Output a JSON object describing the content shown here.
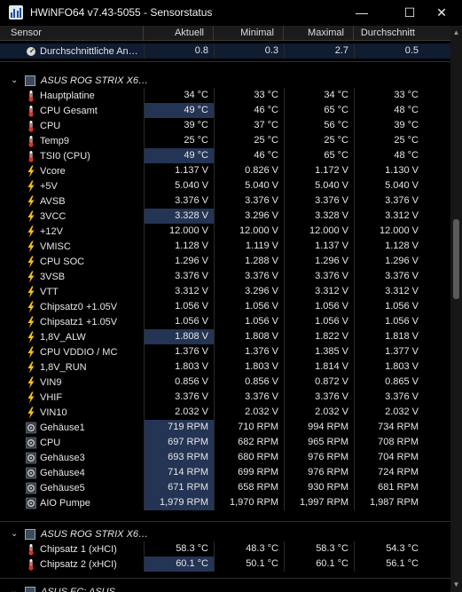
{
  "window": {
    "title": "HWiNFO64 v7.43-5055 - Sensorstatus",
    "minimize": "—",
    "maximize": "☐",
    "close": "✕"
  },
  "columns": {
    "sensor": "Sensor",
    "current": "Aktuell",
    "min": "Minimal",
    "max": "Maximal",
    "avg": "Durchschnitt"
  },
  "top_row": {
    "icon": "gauge-icon",
    "label": "Durchschnittliche An…",
    "current": "0.8",
    "min": "0.3",
    "max": "2.7",
    "avg": "0.5"
  },
  "group1": {
    "name": "ASUS ROG STRIX X6…",
    "rows": [
      {
        "icon": "thermometer-icon",
        "label": "Hauptplatine",
        "current": "34 °C",
        "min": "33 °C",
        "max": "34 °C",
        "avg": "33 °C",
        "hl": ""
      },
      {
        "icon": "thermometer-icon",
        "label": "CPU Gesamt",
        "current": "49 °C",
        "min": "46 °C",
        "max": "65 °C",
        "avg": "48 °C",
        "hl": "hl"
      },
      {
        "icon": "thermometer-icon",
        "label": "CPU",
        "current": "39 °C",
        "min": "37 °C",
        "max": "56 °C",
        "avg": "39 °C",
        "hl": ""
      },
      {
        "icon": "thermometer-icon",
        "label": "Temp9",
        "current": "25 °C",
        "min": "25 °C",
        "max": "25 °C",
        "avg": "25 °C",
        "hl": ""
      },
      {
        "icon": "thermometer-icon",
        "label": "TSI0 (CPU)",
        "current": "49 °C",
        "min": "46 °C",
        "max": "65 °C",
        "avg": "48 °C",
        "hl": "hl"
      },
      {
        "icon": "voltage-icon",
        "label": "Vcore",
        "current": "1.137 V",
        "min": "0.826 V",
        "max": "1.172 V",
        "avg": "1.130 V",
        "hl": ""
      },
      {
        "icon": "voltage-icon",
        "label": "+5V",
        "current": "5.040 V",
        "min": "5.040 V",
        "max": "5.040 V",
        "avg": "5.040 V",
        "hl": ""
      },
      {
        "icon": "voltage-icon",
        "label": "AVSB",
        "current": "3.376 V",
        "min": "3.376 V",
        "max": "3.376 V",
        "avg": "3.376 V",
        "hl": ""
      },
      {
        "icon": "voltage-icon",
        "label": "3VCC",
        "current": "3.328 V",
        "min": "3.296 V",
        "max": "3.328 V",
        "avg": "3.312 V",
        "hl": "hl"
      },
      {
        "icon": "voltage-icon",
        "label": "+12V",
        "current": "12.000 V",
        "min": "12.000 V",
        "max": "12.000 V",
        "avg": "12.000 V",
        "hl": ""
      },
      {
        "icon": "voltage-icon",
        "label": "VMISC",
        "current": "1.128 V",
        "min": "1.119 V",
        "max": "1.137 V",
        "avg": "1.128 V",
        "hl": ""
      },
      {
        "icon": "voltage-icon",
        "label": "CPU SOC",
        "current": "1.296 V",
        "min": "1.288 V",
        "max": "1.296 V",
        "avg": "1.296 V",
        "hl": ""
      },
      {
        "icon": "voltage-icon",
        "label": "3VSB",
        "current": "3.376 V",
        "min": "3.376 V",
        "max": "3.376 V",
        "avg": "3.376 V",
        "hl": ""
      },
      {
        "icon": "voltage-icon",
        "label": "VTT",
        "current": "3.312 V",
        "min": "3.296 V",
        "max": "3.312 V",
        "avg": "3.312 V",
        "hl": ""
      },
      {
        "icon": "voltage-icon",
        "label": "Chipsatz0 +1.05V",
        "current": "1.056 V",
        "min": "1.056 V",
        "max": "1.056 V",
        "avg": "1.056 V",
        "hl": ""
      },
      {
        "icon": "voltage-icon",
        "label": "Chipsatz1 +1.05V",
        "current": "1.056 V",
        "min": "1.056 V",
        "max": "1.056 V",
        "avg": "1.056 V",
        "hl": ""
      },
      {
        "icon": "voltage-icon",
        "label": "1,8V_ALW",
        "current": "1.808 V",
        "min": "1.808 V",
        "max": "1.822 V",
        "avg": "1.818 V",
        "hl": "hl"
      },
      {
        "icon": "voltage-icon",
        "label": "CPU VDDIO / MC",
        "current": "1.376 V",
        "min": "1.376 V",
        "max": "1.385 V",
        "avg": "1.377 V",
        "hl": ""
      },
      {
        "icon": "voltage-icon",
        "label": "1,8V_RUN",
        "current": "1.803 V",
        "min": "1.803 V",
        "max": "1.814 V",
        "avg": "1.803 V",
        "hl": ""
      },
      {
        "icon": "voltage-icon",
        "label": "VIN9",
        "current": "0.856 V",
        "min": "0.856 V",
        "max": "0.872 V",
        "avg": "0.865 V",
        "hl": ""
      },
      {
        "icon": "voltage-icon",
        "label": "VHIF",
        "current": "3.376 V",
        "min": "3.376 V",
        "max": "3.376 V",
        "avg": "3.376 V",
        "hl": ""
      },
      {
        "icon": "voltage-icon",
        "label": "VIN10",
        "current": "2.032 V",
        "min": "2.032 V",
        "max": "2.032 V",
        "avg": "2.032 V",
        "hl": ""
      },
      {
        "icon": "fan-icon",
        "label": "Gehäuse1",
        "current": "719 RPM",
        "min": "710 RPM",
        "max": "994 RPM",
        "avg": "734 RPM",
        "hl": "hl"
      },
      {
        "icon": "fan-icon",
        "label": "CPU",
        "current": "697 RPM",
        "min": "682 RPM",
        "max": "965 RPM",
        "avg": "708 RPM",
        "hl": "hl"
      },
      {
        "icon": "fan-icon",
        "label": "Gehäuse3",
        "current": "693 RPM",
        "min": "680 RPM",
        "max": "976 RPM",
        "avg": "704 RPM",
        "hl": "hl"
      },
      {
        "icon": "fan-icon",
        "label": "Gehäuse4",
        "current": "714 RPM",
        "min": "699 RPM",
        "max": "976 RPM",
        "avg": "724 RPM",
        "hl": "hl"
      },
      {
        "icon": "fan-icon",
        "label": "Gehäuse5",
        "current": "671 RPM",
        "min": "658 RPM",
        "max": "930 RPM",
        "avg": "681 RPM",
        "hl": "hl"
      },
      {
        "icon": "fan-icon",
        "label": "AIO Pumpe",
        "current": "1,979 RPM",
        "min": "1,970 RPM",
        "max": "1,997 RPM",
        "avg": "1,987 RPM",
        "hl": "hl"
      }
    ]
  },
  "group2": {
    "name": "ASUS ROG STRIX X6…",
    "rows": [
      {
        "icon": "thermometer-icon",
        "label": "Chipsatz 1 (xHCI)",
        "current": "58.3 °C",
        "min": "48.3 °C",
        "max": "58.3 °C",
        "avg": "54.3 °C",
        "hl": ""
      },
      {
        "icon": "thermometer-icon",
        "label": "Chipsatz 2 (xHCI)",
        "current": "60.1 °C",
        "min": "50.1 °C",
        "max": "60.1 °C",
        "avg": "56.1 °C",
        "hl": "hl"
      }
    ]
  },
  "group3": {
    "name": "ASUS EC: ASUS"
  }
}
